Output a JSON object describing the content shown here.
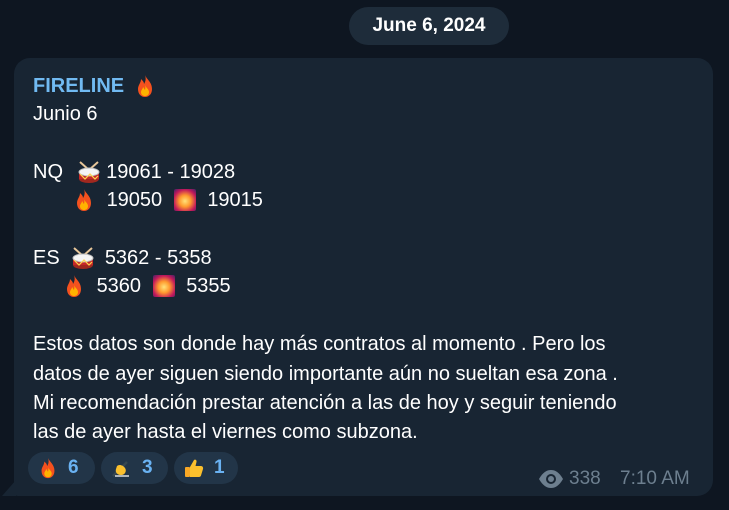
{
  "date_separator": "June 6, 2024",
  "message": {
    "sender": "FIRELINE",
    "lines": {
      "l1": "Junio 6",
      "nq_label": "NQ",
      "nq_range": "19061 - 19028",
      "nq_fire": "19050",
      "nq_firework": "19015",
      "es_label": "ES",
      "es_range": "5362 - 5358",
      "es_fire": "5360",
      "es_firework": "5355",
      "p1": "Estos datos son donde hay más contratos al momento . Pero los",
      "p2": "datos de ayer siguen siendo importante aún no sueltan esa zona .",
      "p3": "Mi recomendación prestar atención a las de hoy y seguir teniendo",
      "p4": "las de ayer hasta el viernes como subzona."
    },
    "reactions": [
      {
        "icon": "fire-emoji",
        "count": "6"
      },
      {
        "icon": "writing-hand-emoji",
        "count": "3"
      },
      {
        "icon": "thumbs-up-emoji",
        "count": "1"
      }
    ],
    "views": "338",
    "time": "7:10 AM"
  },
  "colors": {
    "background": "#0e1621",
    "bubble": "#182533",
    "sender": "#71baf2",
    "reaction_bg": "#223548",
    "reaction_text": "#6ab2f2",
    "meta_text": "#6d7f8f"
  }
}
